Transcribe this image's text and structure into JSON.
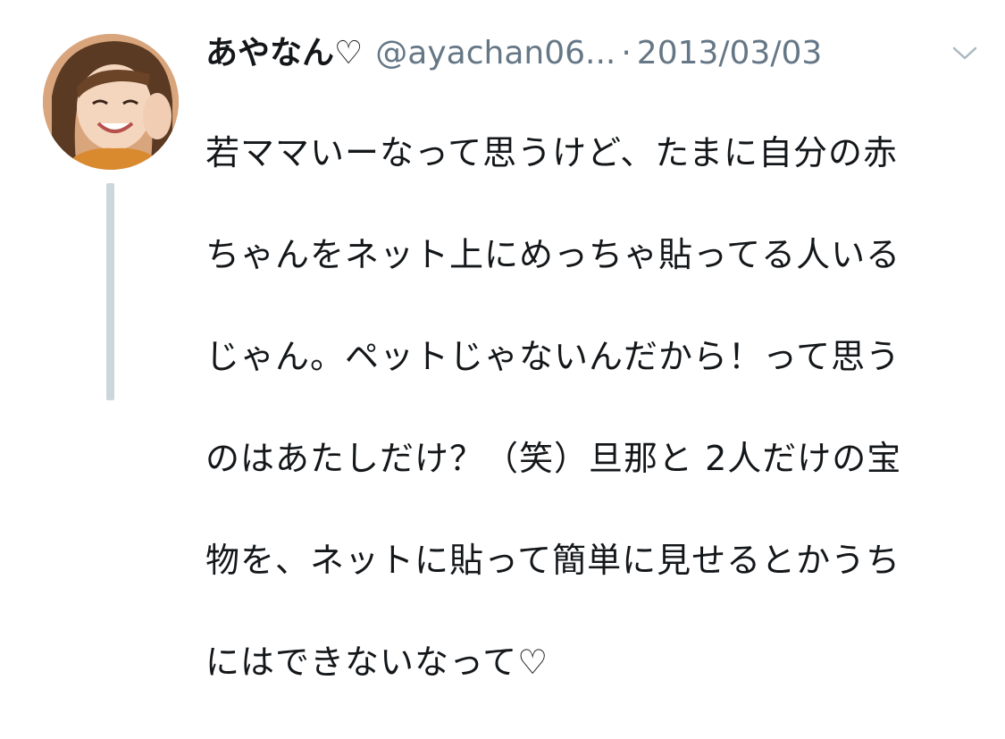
{
  "tweet": {
    "display_name": "あやなん♡",
    "handle": "@ayachan06...",
    "separator": "·",
    "date": "2013/03/03",
    "text_lines": [
      "若ママいーなって思うけど、たまに自分の赤",
      "ちゃんをネット上にめっちゃ貼ってる人いる",
      "じゃん。ペットじゃないんだから！って思う",
      "のはあたしだけ？（笑）旦那と 2人だけの宝",
      "物を、ネットに貼って簡単に見せるとかうち",
      "にはできないなって♡"
    ]
  },
  "icons": {
    "avatar": "user-avatar",
    "menu": "chevron-down-icon"
  },
  "colors": {
    "text": "#14171a",
    "secondary": "#657786",
    "thread_line": "#ccd6dd",
    "background": "#ffffff"
  }
}
